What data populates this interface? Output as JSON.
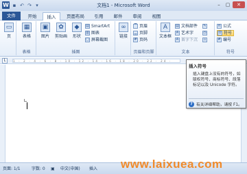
{
  "window": {
    "title": "文档1 - Microsoft Word",
    "app_icon": "W",
    "qat": {
      "save": "▪",
      "undo": "↶",
      "redo": "↷",
      "customize": "▾"
    },
    "controls": {
      "minimize": "–",
      "maximize": "▢",
      "close": "✕"
    }
  },
  "tabs": [
    "文件",
    "开始",
    "插入",
    "页面布局",
    "引用",
    "邮件",
    "审阅",
    "视图"
  ],
  "active_tab": "插入",
  "ribbon": {
    "pages": {
      "label": "页"
    },
    "tables": {
      "table": "表格",
      "group": "表格"
    },
    "illustrations": {
      "picture": "图片",
      "clipart": "剪贴画",
      "shapes": "形状",
      "smartart": "SmartArt",
      "chart": "图表",
      "screenshot": "屏幕截图",
      "group": "插图"
    },
    "links": {
      "link": "链接"
    },
    "header_footer": {
      "header": "页眉",
      "footer": "页脚",
      "page_number": "页码",
      "group": "页眉和页脚"
    },
    "text": {
      "textbox": "文本框",
      "quickparts": "文档部件",
      "wordart": "艺术字",
      "dropcap": "首字下沉",
      "group": "文本"
    },
    "symbols": {
      "equation": "公式",
      "symbol": "符号",
      "number": "编号",
      "group": "符号"
    }
  },
  "ruler": {
    "ticks": "1 · 2 · 4 · 6 · 8 · 10 · 12 · 14 · 16 · 18 · 20 · 22 · 24 · 26"
  },
  "tooltip": {
    "title": "插入符号",
    "body": "插入键盘上没有的符号，如版权符号、商标符号、段落标记以及 Unicode 字符。",
    "help": "有关详细帮助，请按 F1。"
  },
  "statusbar": {
    "page": "页面: 1/1",
    "words": "字数: 0",
    "lang": "中文(中国)",
    "mode": "插入"
  },
  "watermark": "www.laixuea.com"
}
